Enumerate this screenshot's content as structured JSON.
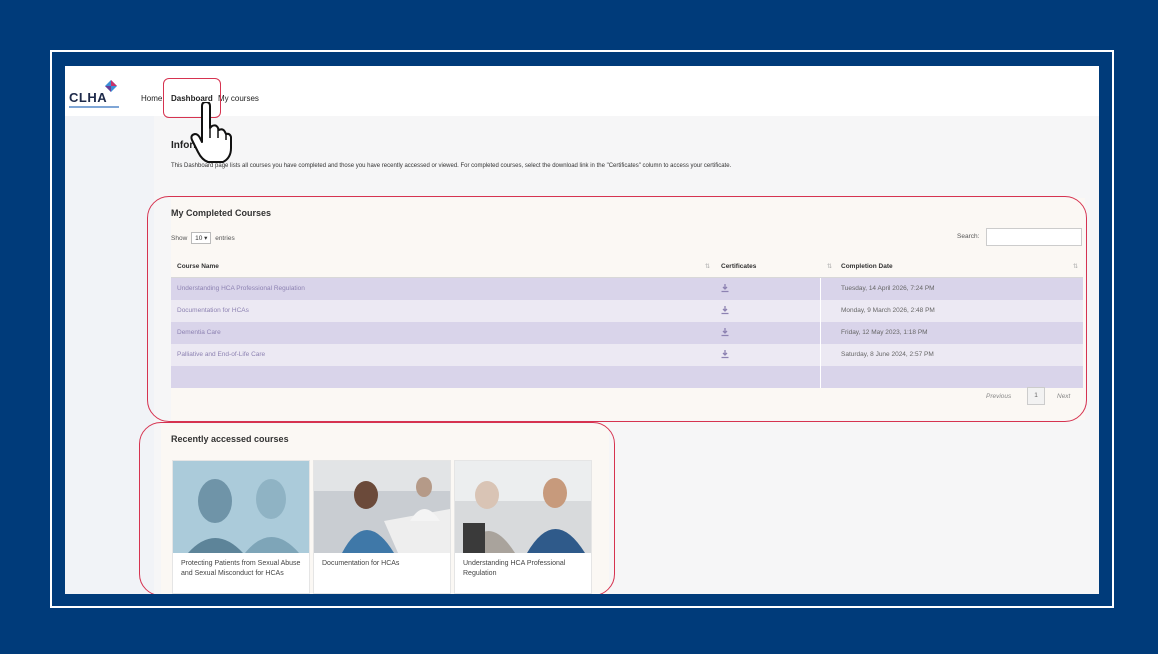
{
  "header": {
    "logo_text": "CLHA",
    "nav": {
      "home": "Home",
      "dashboard": "Dashboard",
      "my_courses": "My courses"
    }
  },
  "info": {
    "heading": "Information",
    "text": "This Dashboard page lists all courses you have completed and those you have recently accessed or viewed. For completed courses, select the download link in the \"Certificates\" column to access your certificate."
  },
  "completed": {
    "title": "My Completed Courses",
    "show_label": "Show",
    "entries_value": "10",
    "entries_label": "entries",
    "search_label": "Search:",
    "columns": [
      "Course Name",
      "Certificates",
      "Completion Date"
    ],
    "rows": [
      {
        "name": "Understanding HCA Professional Regulation",
        "date": "Tuesday, 14 April 2026, 7:24 PM"
      },
      {
        "name": "Documentation for HCAs",
        "date": "Monday, 9 March 2026, 2:48 PM"
      },
      {
        "name": "Dementia Care",
        "date": "Friday, 12 May 2023, 1:18 PM"
      },
      {
        "name": "Palliative and End-of-Life Care",
        "date": "Saturday, 8 June 2024, 2:57 PM"
      }
    ],
    "pager": {
      "previous": "Previous",
      "page": "1",
      "next": "Next"
    }
  },
  "recent": {
    "title": "Recently accessed courses",
    "cards": [
      {
        "label": "Protecting Patients from Sexual Abuse and Sexual Misconduct for HCAs"
      },
      {
        "label": "Documentation for HCAs"
      },
      {
        "label": "Understanding HCA Professional Regulation"
      }
    ]
  },
  "colors": {
    "frame_blue": "#003b7a",
    "highlight_red": "#d63350",
    "row_odd": "#d9d4ea",
    "row_even": "#ece9f3",
    "link_purple": "#8d82b2"
  },
  "icons": [
    "download-icon",
    "pointing-hand-cursor-icon",
    "chevron-down-icon",
    "sort-icon"
  ]
}
